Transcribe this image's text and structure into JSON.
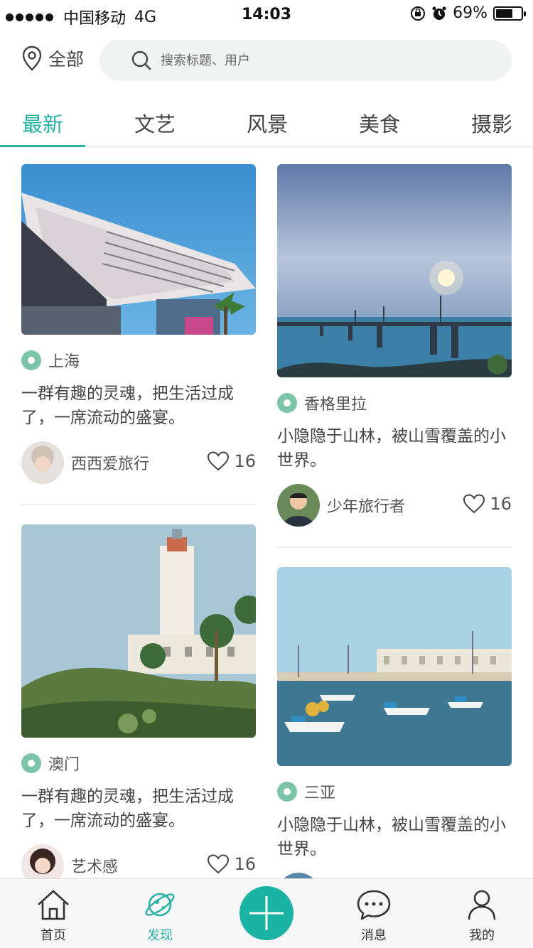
{
  "status": {
    "carrier": "中国移动",
    "network": "4G",
    "time": "14:03",
    "battery": "69%",
    "battery_level": 0.69
  },
  "header": {
    "location_label": "全部",
    "search_placeholder": "搜索标题、用户"
  },
  "tabs": [
    {
      "label": "最新",
      "active": true
    },
    {
      "label": "文艺",
      "active": false
    },
    {
      "label": "风景",
      "active": false
    },
    {
      "label": "美食",
      "active": false
    },
    {
      "label": "摄影",
      "active": false
    }
  ],
  "feed": {
    "left": [
      {
        "location": "上海",
        "desc": "一群有趣的灵魂，把生活过成了，一席流动的盛宴。",
        "user": "西西爱旅行",
        "likes": "16"
      },
      {
        "location": "澳门",
        "desc": "一群有趣的灵魂，把生活过成了，一席流动的盛宴。",
        "user": "艺术感",
        "likes": "16"
      }
    ],
    "right": [
      {
        "location": "香格里拉",
        "desc": "小隐隐于山林，被山雪覆盖的小世界。",
        "user": "少年旅行者",
        "likes": "16"
      },
      {
        "location": "三亚",
        "desc": "小隐隐于山林，被山雪覆盖的小世界。"
      }
    ]
  },
  "bottom_nav": [
    {
      "label": "首页",
      "icon": "home-icon"
    },
    {
      "label": "发现",
      "icon": "planet-icon",
      "active": true
    },
    {
      "label": "",
      "icon": "plus-icon"
    },
    {
      "label": "消息",
      "icon": "chat-icon"
    },
    {
      "label": "我的",
      "icon": "user-icon"
    }
  ],
  "colors": {
    "accent": "#27b2a5",
    "pin": "#7bc4a8"
  }
}
